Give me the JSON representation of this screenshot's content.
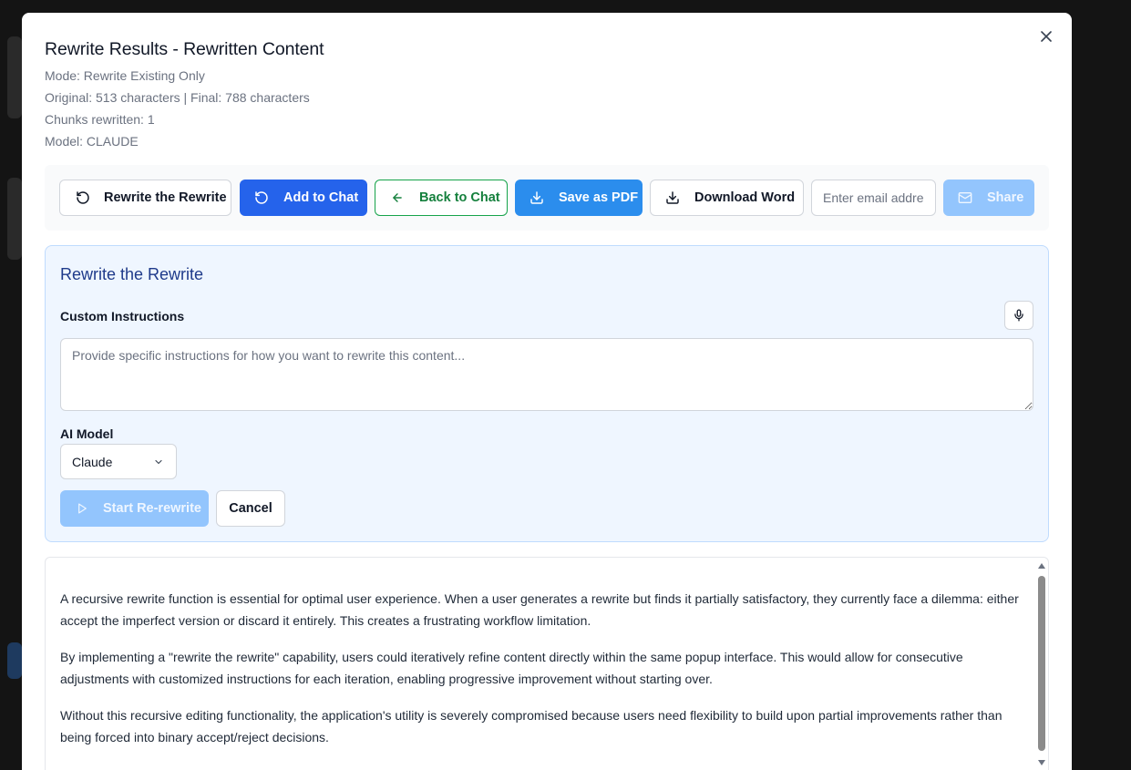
{
  "modal": {
    "title": "Rewrite Results - Rewritten Content",
    "mode": "Mode: Rewrite Existing Only",
    "stats": "Original: 513 characters | Final: 788 characters",
    "chunks": "Chunks rewritten: 1",
    "model": "Model: CLAUDE"
  },
  "toolbar": {
    "rewrite_label": "Rewrite the Rewrite",
    "add_chat_label": "Add to Chat",
    "back_chat_label": "Back to Chat",
    "save_pdf_label": "Save as PDF",
    "download_word_label": "Download Word",
    "email_placeholder": "Enter email address",
    "email_value": "",
    "share_label": "Share"
  },
  "panel": {
    "title": "Rewrite the Rewrite",
    "instructions_label": "Custom Instructions",
    "instructions_placeholder": "Provide specific instructions for how you want to rewrite this content...",
    "instructions_value": "",
    "model_label": "AI Model",
    "model_selected": "Claude",
    "start_label": "Start Re-rewrite",
    "cancel_label": "Cancel"
  },
  "content": {
    "paragraphs": [
      "A recursive rewrite function is essential for optimal user experience. When a user generates a rewrite but finds it partially satisfactory, they currently face a dilemma: either accept the imperfect version or discard it entirely. This creates a frustrating workflow limitation.",
      "By implementing a \"rewrite the rewrite\" capability, users could iteratively refine content directly within the same popup interface. This would allow for consecutive adjustments with customized instructions for each iteration, enabling progressive improvement without starting over.",
      "Without this recursive editing functionality, the application's utility is severely compromised because users need flexibility to build upon partial improvements rather than being forced into binary accept/reject decisions."
    ]
  },
  "colors": {
    "primary": "#2563eb",
    "save_pdf": "#2b8ded",
    "back_green": "#16a34a",
    "disabled_blue": "#93c5fd",
    "panel_bg": "#eff6ff",
    "panel_title": "#1e3a8a"
  },
  "icons": {
    "close": "close-icon",
    "rewrite": "rotate-ccw-icon",
    "add_chat": "rotate-ccw-icon",
    "back": "arrow-left-icon",
    "save_pdf": "download-icon",
    "download_word": "download-icon",
    "share": "mail-icon",
    "mic": "microphone-icon",
    "select": "chevron-down-icon",
    "start": "play-icon"
  }
}
